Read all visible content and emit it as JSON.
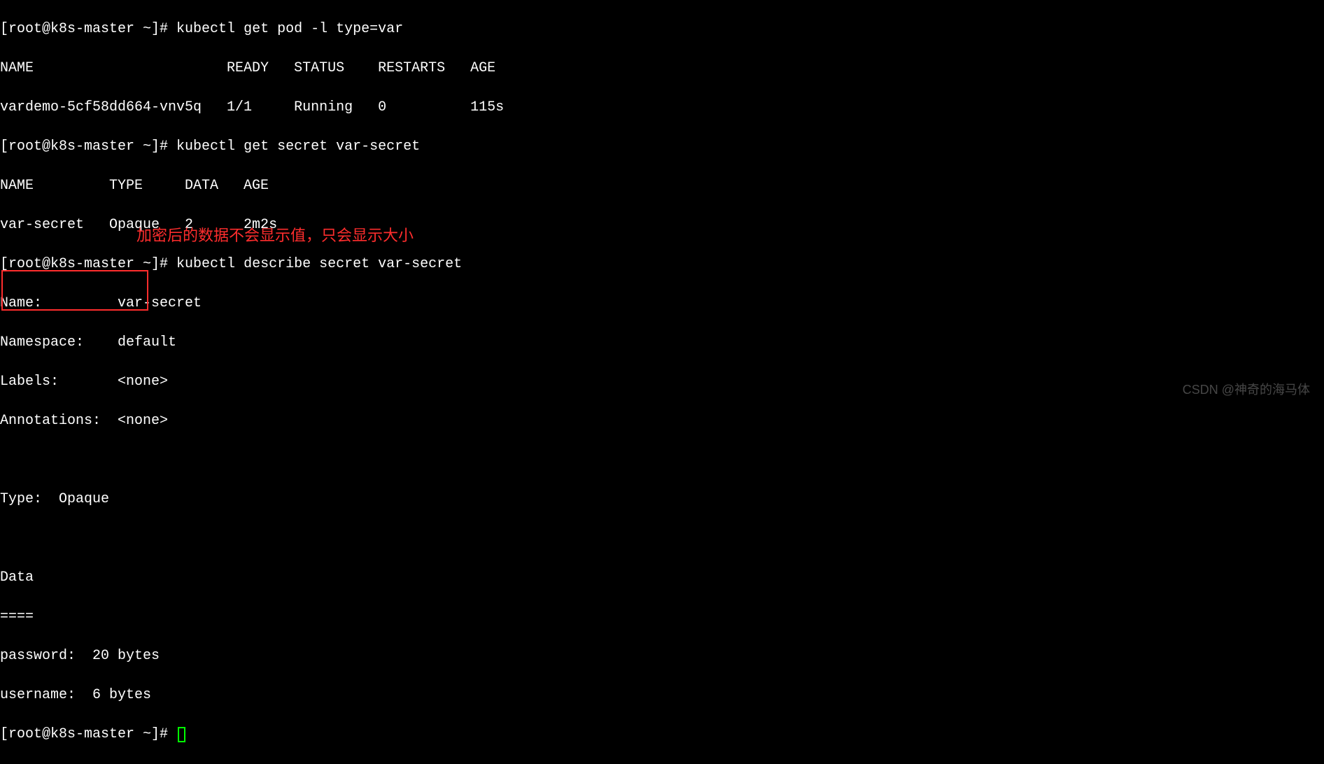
{
  "prompt1": "[root@k8s-master ~]# ",
  "cmd1": "kubectl get pod -l type=var",
  "pod_header": "NAME                       READY   STATUS    RESTARTS   AGE",
  "pod_row": "vardemo-5cf58dd664-vnv5q   1/1     Running   0          115s",
  "prompt2": "[root@k8s-master ~]# ",
  "cmd2": "kubectl get secret var-secret",
  "sec_header": "NAME         TYPE     DATA   AGE",
  "sec_row": "var-secret   Opaque   2      2m2s",
  "prompt3": "[root@k8s-master ~]# ",
  "cmd3": "kubectl describe secret var-secret",
  "d_name": "Name:         var-secret",
  "d_namespace": "Namespace:    default",
  "d_labels": "Labels:       <none>",
  "d_annotations": "Annotations:  <none>",
  "d_type": "Type:  Opaque",
  "d_data": "Data",
  "d_sep": "====",
  "d_password": "password:  20 bytes",
  "d_username": "username:  6 bytes",
  "prompt4": "[root@k8s-master ~]# ",
  "annotation_text": "加密后的数据不会显示值，只会显示大小",
  "watermark": "CSDN @神奇的海马体"
}
